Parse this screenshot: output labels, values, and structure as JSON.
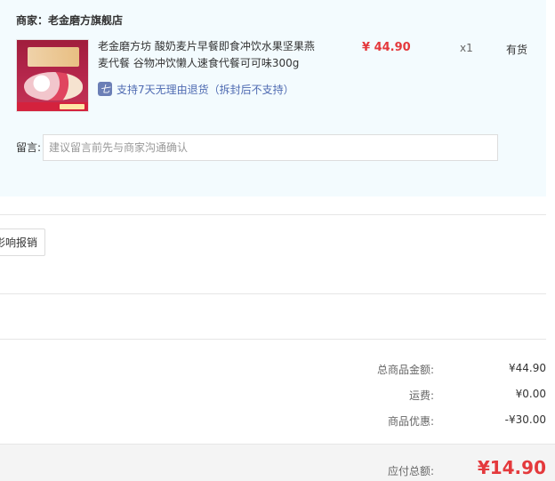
{
  "merchant": {
    "label": "商家：老金磨方旗舰店"
  },
  "product": {
    "name": "老金磨方坊 酸奶麦片早餐即食冲饮水果坚果燕麦代餐 谷物冲饮懒人速食代餐可可味300g",
    "price": "¥ 44.90",
    "quantity": "x1",
    "stock": "有货",
    "return_policy": "支持7天无理由退货（拆封后不支持）",
    "return_icon_glyph": "七"
  },
  "remark": {
    "label": "留言:",
    "placeholder": "建议留言前先与商家沟通确认"
  },
  "report_button": "影响报销",
  "summary": [
    {
      "label": "总商品金额:",
      "value": "¥44.90"
    },
    {
      "label": "运费:",
      "value": "¥0.00"
    },
    {
      "label": "商品优惠:",
      "value": "-¥30.00"
    }
  ],
  "total": {
    "label": "应付总额:",
    "value": "¥14.90"
  },
  "colors": {
    "panel_bg": "#f3fbfe",
    "price_red": "#e4393c",
    "link_blue": "#4f6bb2",
    "icon_blue": "#6b7fb6"
  },
  "icons": {
    "return": "return-policy-icon",
    "product": "product-thumbnail"
  }
}
